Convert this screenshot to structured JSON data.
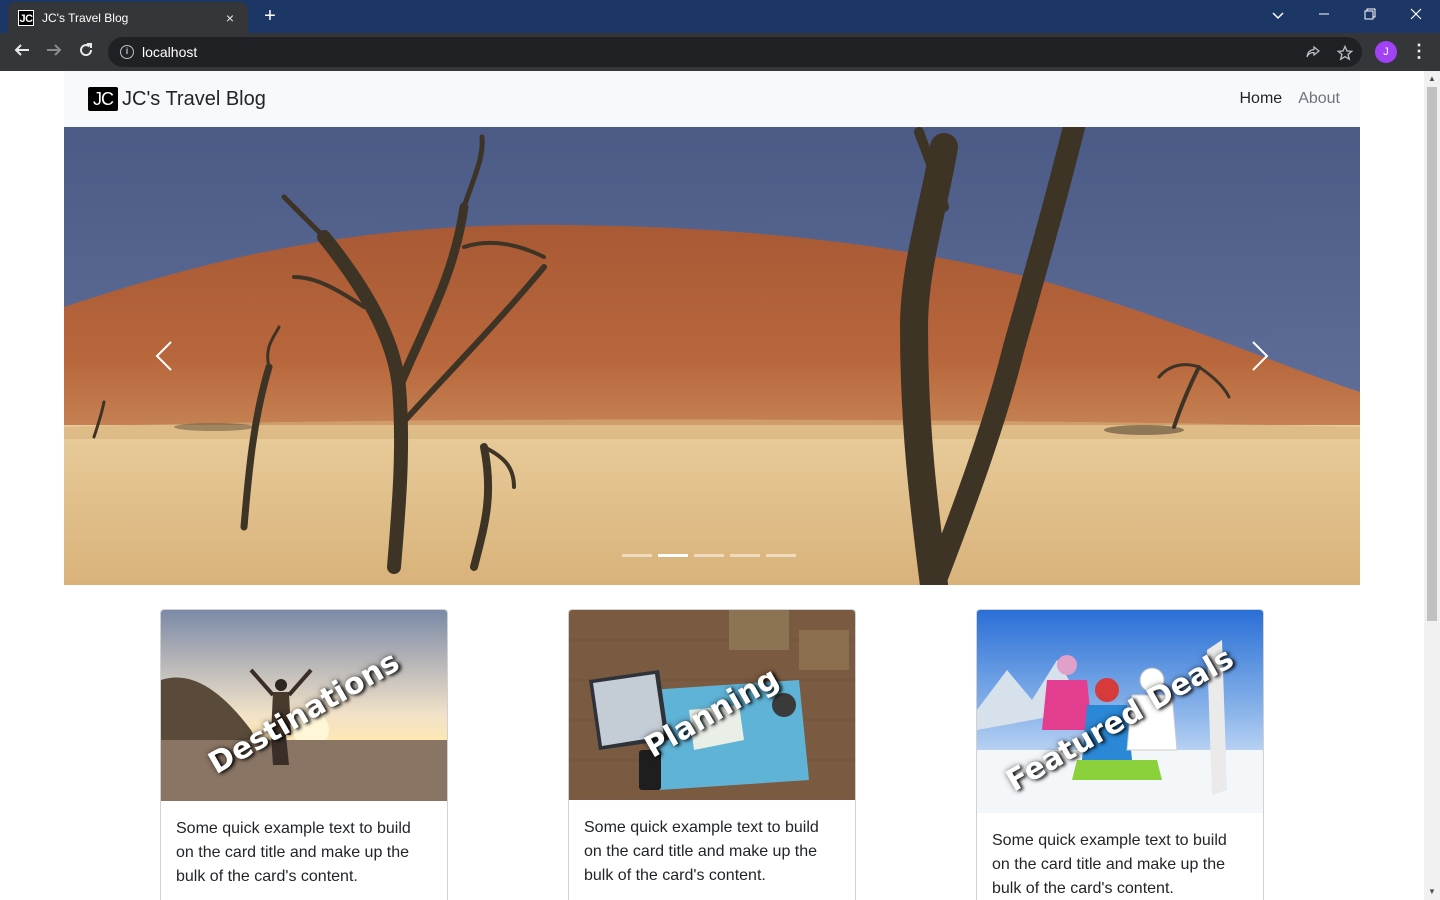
{
  "browser": {
    "tab_title": "JC's Travel Blog",
    "favicon_text": "JC",
    "tab_close_icon": "×",
    "new_tab_icon": "+",
    "url": "localhost",
    "avatar_letter": "J",
    "accent_color": "#1c3665"
  },
  "navbar": {
    "brand_logo": "JC",
    "brand_text": "JC's Travel Blog",
    "links": [
      {
        "label": "Home"
      },
      {
        "label": "About"
      }
    ]
  },
  "carousel": {
    "slide_count": 5,
    "active_index": 1,
    "prev_icon": "chevron-left-icon",
    "next_icon": "chevron-right-icon"
  },
  "cards": [
    {
      "overlay": "Destinations",
      "text": "Some quick example text to build on the card title and make up the bulk of the card's content."
    },
    {
      "overlay": "Planning",
      "text": "Some quick example text to build on the card title and make up the bulk of the card's content."
    },
    {
      "overlay": "Featured Deals",
      "text": "Some quick example text to build on the card title and make up the bulk of the card's content."
    }
  ]
}
